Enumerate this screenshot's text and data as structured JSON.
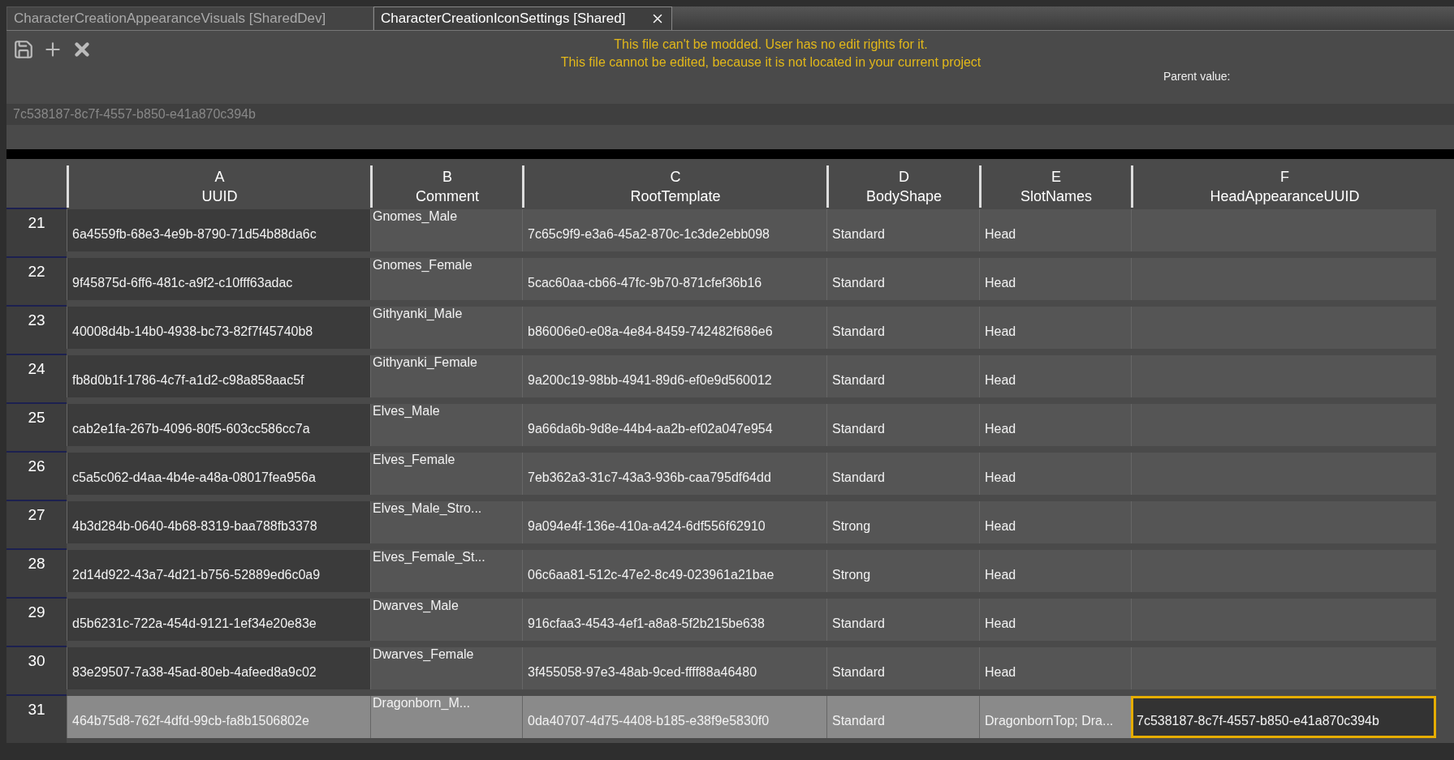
{
  "tabs": [
    {
      "label": "CharacterCreationAppearanceVisuals [SharedDev]",
      "selected": false
    },
    {
      "label": "CharacterCreationIconSettings [Shared]",
      "selected": true
    }
  ],
  "toolbar": {
    "warnings": [
      "This file can't be modded. User has no edit rights for it.",
      "This file cannot be edited, because it is not located in your current project"
    ],
    "parent_label": "Parent value:"
  },
  "value_field": {
    "value": "7c538187-8c7f-4557-b850-e41a870c394b"
  },
  "table": {
    "columns": [
      {
        "letter": "A",
        "name": "UUID"
      },
      {
        "letter": "B",
        "name": "Comment"
      },
      {
        "letter": "C",
        "name": "RootTemplate"
      },
      {
        "letter": "D",
        "name": "BodyShape"
      },
      {
        "letter": "E",
        "name": "SlotNames"
      },
      {
        "letter": "F",
        "name": "HeadAppearanceUUID"
      }
    ],
    "rows": [
      {
        "number": "21",
        "selected": false,
        "cells": [
          {
            "text": "6a4559fb-68e3-4e9b-8790-71d54b88da6c",
            "focused": false
          },
          {
            "text": "Gnomes_Male",
            "focused": false
          },
          {
            "text": "7c65c9f9-e3a6-45a2-870c-1c3de2ebb098",
            "focused": false
          },
          {
            "text": "Standard",
            "focused": false
          },
          {
            "text": "Head",
            "focused": false
          },
          {
            "focused": false
          }
        ]
      },
      {
        "number": "22",
        "selected": false,
        "cells": [
          {
            "text": "9f45875d-6ff6-481c-a9f2-c10fff63adac",
            "focused": false
          },
          {
            "text": "Gnomes_Female",
            "focused": false
          },
          {
            "text": "5cac60aa-cb66-47fc-9b70-871cfef36b16",
            "focused": false
          },
          {
            "text": "Standard",
            "focused": false
          },
          {
            "text": "Head",
            "focused": false
          },
          {
            "focused": false
          }
        ]
      },
      {
        "number": "23",
        "selected": false,
        "cells": [
          {
            "text": "40008d4b-14b0-4938-bc73-82f7f45740b8",
            "focused": false
          },
          {
            "text": "Githyanki_Male",
            "focused": false
          },
          {
            "text": "b86006e0-e08a-4e84-8459-742482f686e6",
            "focused": false
          },
          {
            "text": "Standard",
            "focused": false
          },
          {
            "text": "Head",
            "focused": false
          },
          {
            "focused": false
          }
        ]
      },
      {
        "number": "24",
        "selected": false,
        "cells": [
          {
            "text": "fb8d0b1f-1786-4c7f-a1d2-c98a858aac5f",
            "focused": false
          },
          {
            "text": "Githyanki_Female",
            "focused": false
          },
          {
            "text": "9a200c19-98bb-4941-89d6-ef0e9d560012",
            "focused": false
          },
          {
            "text": "Standard",
            "focused": false
          },
          {
            "text": "Head",
            "focused": false
          },
          {
            "focused": false
          }
        ]
      },
      {
        "number": "25",
        "selected": false,
        "cells": [
          {
            "text": "cab2e1fa-267b-4096-80f5-603cc586cc7a",
            "focused": false
          },
          {
            "text": "Elves_Male",
            "focused": false
          },
          {
            "text": "9a66da6b-9d8e-44b4-aa2b-ef02a047e954",
            "focused": false
          },
          {
            "text": "Standard",
            "focused": false
          },
          {
            "text": "Head",
            "focused": false
          },
          {
            "focused": false
          }
        ]
      },
      {
        "number": "26",
        "selected": false,
        "cells": [
          {
            "text": "c5a5c062-d4aa-4b4e-a48a-08017fea956a",
            "focused": false
          },
          {
            "text": "Elves_Female",
            "focused": false
          },
          {
            "text": "7eb362a3-31c7-43a3-936b-caa795df64dd",
            "focused": false
          },
          {
            "text": "Standard",
            "focused": false
          },
          {
            "text": "Head",
            "focused": false
          },
          {
            "focused": false
          }
        ]
      },
      {
        "number": "27",
        "selected": false,
        "cells": [
          {
            "text": "4b3d284b-0640-4b68-8319-baa788fb3378",
            "focused": false
          },
          {
            "text": "Elves_Male_Stro...",
            "focused": false
          },
          {
            "text": "9a094e4f-136e-410a-a424-6df556f62910",
            "focused": false
          },
          {
            "text": "Strong",
            "focused": false
          },
          {
            "text": "Head",
            "focused": false
          },
          {
            "focused": false
          }
        ]
      },
      {
        "number": "28",
        "selected": false,
        "cells": [
          {
            "text": "2d14d922-43a7-4d21-b756-52889ed6c0a9",
            "focused": false
          },
          {
            "text": "Elves_Female_St...",
            "focused": false
          },
          {
            "text": "06c6aa81-512c-47e2-8c49-023961a21bae",
            "focused": false
          },
          {
            "text": "Strong",
            "focused": false
          },
          {
            "text": "Head",
            "focused": false
          },
          {
            "focused": false
          }
        ]
      },
      {
        "number": "29",
        "selected": false,
        "cells": [
          {
            "text": "d5b6231c-722a-454d-9121-1ef34e20e83e",
            "focused": false
          },
          {
            "text": "Dwarves_Male",
            "focused": false
          },
          {
            "text": "916cfaa3-4543-4ef1-a8a8-5f2b215be638",
            "focused": false
          },
          {
            "text": "Standard",
            "focused": false
          },
          {
            "text": "Head",
            "focused": false
          },
          {
            "focused": false
          }
        ]
      },
      {
        "number": "30",
        "selected": false,
        "cells": [
          {
            "text": "83e29507-7a38-45ad-80eb-4afeed8a9c02",
            "focused": false
          },
          {
            "text": "Dwarves_Female",
            "focused": false
          },
          {
            "text": "3f455058-97e3-48ab-9ced-ffff88a46480",
            "focused": false
          },
          {
            "text": "Standard",
            "focused": false
          },
          {
            "text": "Head",
            "focused": false
          },
          {
            "focused": false
          }
        ]
      },
      {
        "number": "31",
        "selected": true,
        "cells": [
          {
            "text": "464b75d8-762f-4dfd-99cb-fa8b1506802e",
            "focused": false
          },
          {
            "text": "Dragonborn_M...",
            "focused": false
          },
          {
            "text": "0da40707-4d75-4408-b185-e38f9e5830f0",
            "focused": false
          },
          {
            "text": "Standard",
            "focused": false
          },
          {
            "text": "DragonbornTop; Dra...",
            "focused": false
          },
          {
            "text": "7c538187-8c7f-4557-b850-e41a870c394b",
            "focused": true
          }
        ]
      }
    ]
  }
}
